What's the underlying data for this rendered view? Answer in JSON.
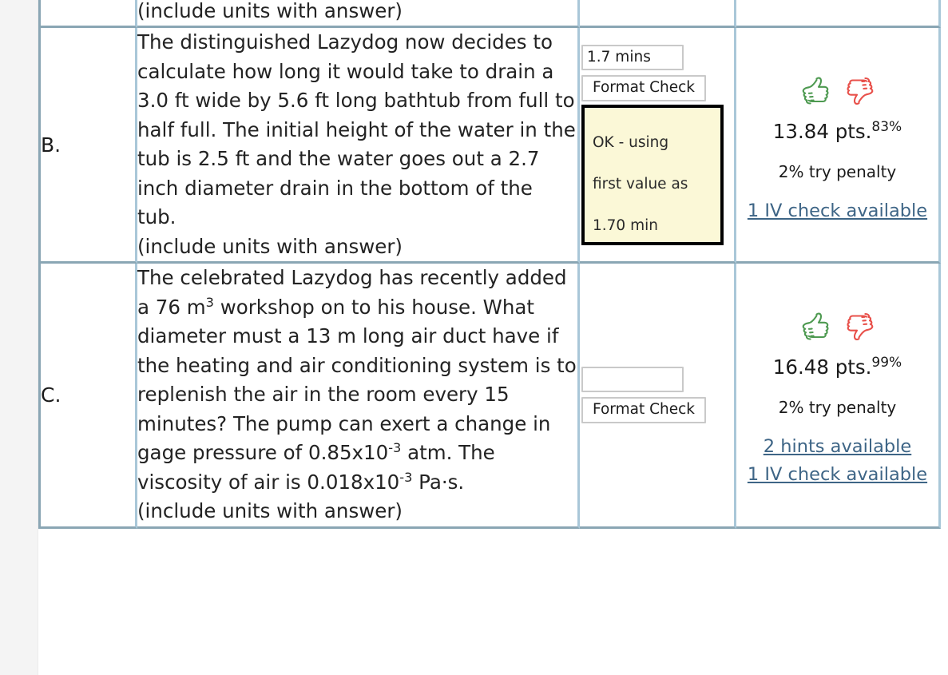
{
  "page": {
    "gutter_color": "#f4f4f4",
    "table_border_color": "#8aa6b4",
    "link_color": "#3e6586"
  },
  "table": {
    "columns": [
      "label",
      "problem",
      "answer",
      "score"
    ],
    "rows": [
      {
        "label": "",
        "problem_tail": "(include units with answer)",
        "clipped": true,
        "answer": {
          "value": "",
          "placeholder": "",
          "format_check_label": "",
          "message": ""
        },
        "score": {
          "points": "",
          "percent": "",
          "penalty": "",
          "links": []
        }
      },
      {
        "label": "B.",
        "problem_lines": [
          "The distinguished Lazydog now",
          "decides to calculate how long it",
          "would take to drain a 3.0 ft wide by",
          "5.6 ft long bathtub from full to half",
          "full. The initial height of the water in",
          "the tub is 2.5 ft and the water goes",
          "out a 2.7 inch diameter drain in the",
          "bottom of the tub.",
          "(include units with answer)"
        ],
        "answer": {
          "value": "1.7 mins",
          "placeholder": "",
          "format_check_label": "Format Check",
          "message": "OK - using\nfirst value as\n1.70 min"
        },
        "score": {
          "points": "13.84 pts.",
          "percent": "83%",
          "penalty": "2% try penalty",
          "links": [
            "1 IV check available"
          ],
          "thumbs_up_color": "#4e9a51",
          "thumbs_down_color": "#e8504a"
        }
      },
      {
        "label": "C.",
        "problem_html_lines": [
          "The celebrated Lazydog has recently",
          "added a 76 m&sup3; workshop on to his",
          "house. What diameter must a 13 m",
          "long air duct have if the heating and",
          "air conditioning system is to",
          "replenish the air in the room every",
          "15 minutes? The pump can exert a",
          "change in gage pressure of",
          "0.85x10&minus;3 atm. The viscosity of air",
          "is 0.018x10&minus;3 Pa&middot;s.",
          "(include units with answer)"
        ],
        "answer": {
          "value": "",
          "placeholder": "",
          "format_check_label": "Format Check",
          "message": ""
        },
        "score": {
          "points": "16.48 pts.",
          "percent": "99%",
          "penalty": "2% try penalty",
          "links": [
            "2 hints available",
            "1 IV check available"
          ],
          "thumbs_up_color": "#4e9a51",
          "thumbs_down_color": "#e8504a"
        }
      }
    ]
  },
  "problem_b": {
    "label": "B.",
    "text": "The distinguished Lazydog now decides to calculate how long it would take to drain a 3.0 ft wide by 5.6 ft long bathtub from full to half full. The initial height of the water in the tub is 2.5 ft and the water goes out a 2.7 inch diameter drain in the bottom of the tub.",
    "note": "(include units with answer)",
    "answer_value": "1.7 mins",
    "format_check_label": "Format Check",
    "format_message": "OK - using first value as 1.70 min",
    "format_message_l1": "OK - using",
    "format_message_l2": "first value as",
    "format_message_l3": "1.70 min",
    "points": "13.84 pts.",
    "percent": "83%",
    "penalty": "2% try penalty",
    "link_iv": "1 IV check available"
  },
  "problem_c": {
    "label": "C.",
    "text_p1": "The celebrated Lazydog has recently added a 76 m",
    "sup_1": "3",
    "text_p2": " workshop on to his house. What diameter must a 13 m long air duct have if the heating and air conditioning system is to replenish the air in the room every 15 minutes? The pump can exert a change in gage pressure of 0.85x10",
    "sup_2": "-3",
    "text_p3": " atm. The viscosity of air is 0.018x10",
    "sup_3": "-3",
    "text_p4": " Pa·s.",
    "note": "(include units with answer)",
    "answer_value": "",
    "format_check_label": "Format Check",
    "points": "16.48 pts.",
    "percent": "99%",
    "penalty": "2% try penalty",
    "link_hints": "2 hints available",
    "link_iv": "1 IV check available"
  },
  "problem_a_tail": {
    "note": "(include units with answer)"
  },
  "icons": {
    "thumbs_up": "thumbs-up-icon",
    "thumbs_down": "thumbs-down-icon"
  }
}
